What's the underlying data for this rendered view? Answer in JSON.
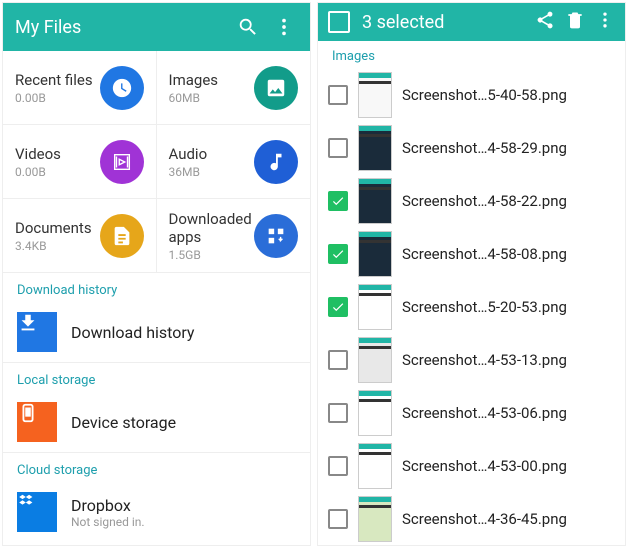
{
  "left": {
    "title": "My Files",
    "tiles": [
      {
        "name": "Recent files",
        "sub": "0.00B"
      },
      {
        "name": "Images",
        "sub": "60MB"
      },
      {
        "name": "Videos",
        "sub": "0.00B"
      },
      {
        "name": "Audio",
        "sub": "36MB"
      },
      {
        "name": "Documents",
        "sub": "3.4KB"
      },
      {
        "name": "Downloaded apps",
        "sub": "1.5GB"
      }
    ],
    "sections": {
      "download": "Download history",
      "download_item": "Download history",
      "local": "Local storage",
      "local_item": "Device storage",
      "cloud": "Cloud storage",
      "cloud_item": "Dropbox",
      "cloud_sub": "Not signed in."
    }
  },
  "right": {
    "selected_text": "3 selected",
    "section": "Images",
    "files": [
      {
        "name": "Screenshot…5-40-58.png",
        "checked": false
      },
      {
        "name": "Screenshot…4-58-29.png",
        "checked": false
      },
      {
        "name": "Screenshot…4-58-22.png",
        "checked": true
      },
      {
        "name": "Screenshot…4-58-08.png",
        "checked": true
      },
      {
        "name": "Screenshot…5-20-53.png",
        "checked": true
      },
      {
        "name": "Screenshot…4-53-13.png",
        "checked": false
      },
      {
        "name": "Screenshot…4-53-06.png",
        "checked": false
      },
      {
        "name": "Screenshot…4-53-00.png",
        "checked": false
      },
      {
        "name": "Screenshot…4-36-45.png",
        "checked": false
      }
    ]
  }
}
